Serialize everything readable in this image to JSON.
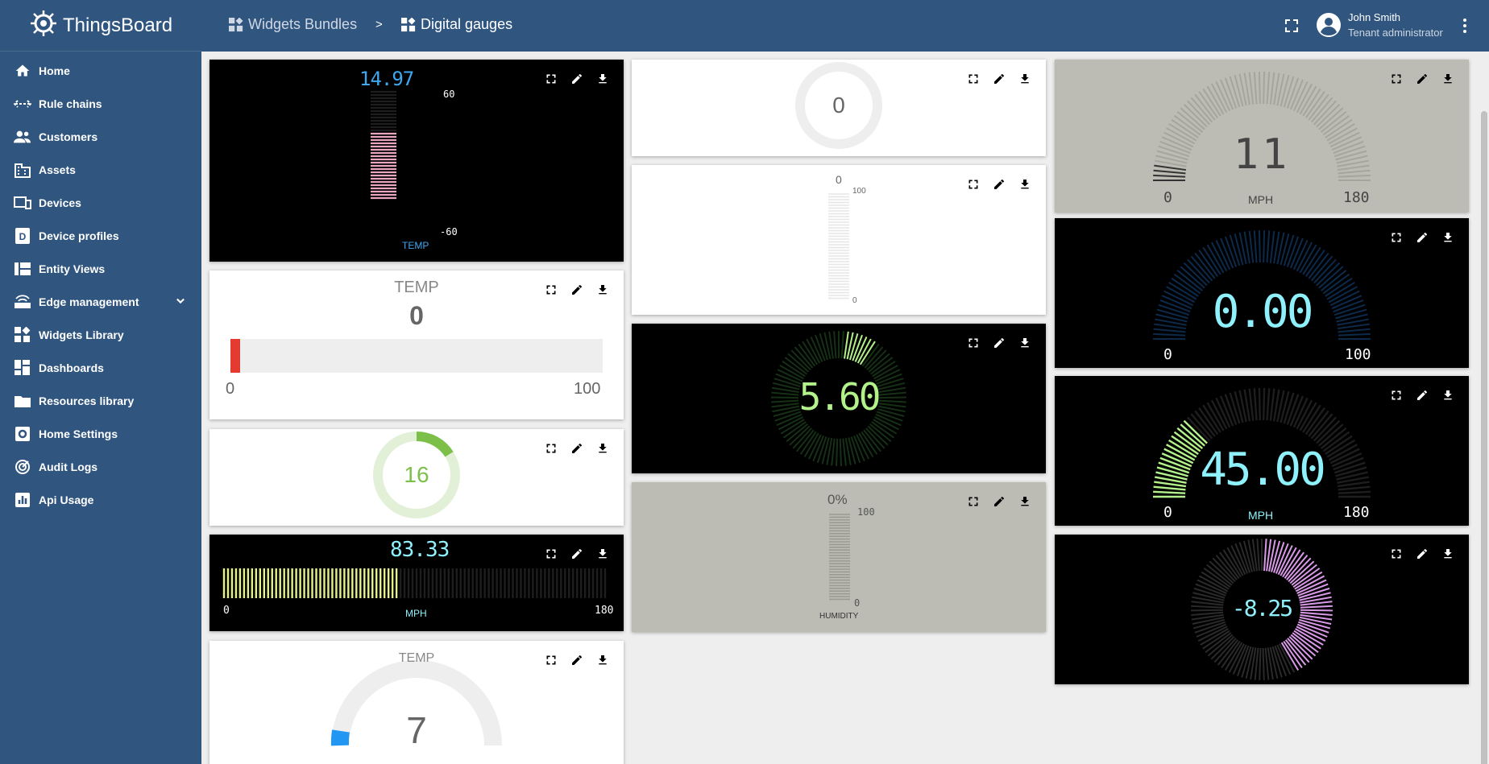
{
  "app": {
    "name": "ThingsBoard"
  },
  "sidebar": {
    "items": [
      {
        "label": "Home",
        "icon": "home-icon"
      },
      {
        "label": "Rule chains",
        "icon": "rule-chain-icon"
      },
      {
        "label": "Customers",
        "icon": "customers-icon"
      },
      {
        "label": "Assets",
        "icon": "assets-icon"
      },
      {
        "label": "Devices",
        "icon": "devices-icon"
      },
      {
        "label": "Device profiles",
        "icon": "device-profile-icon"
      },
      {
        "label": "Entity Views",
        "icon": "entity-views-icon"
      },
      {
        "label": "Edge management",
        "icon": "edge-icon"
      },
      {
        "label": "Widgets Library",
        "icon": "widgets-icon"
      },
      {
        "label": "Dashboards",
        "icon": "dashboards-icon"
      },
      {
        "label": "Resources library",
        "icon": "folder-icon"
      },
      {
        "label": "Home Settings",
        "icon": "settings-icon"
      },
      {
        "label": "Audit Logs",
        "icon": "audit-icon"
      },
      {
        "label": "Api Usage",
        "icon": "api-usage-icon"
      }
    ]
  },
  "header": {
    "breadcrumb": [
      {
        "label": "Widgets Bundles"
      },
      {
        "label": "Digital gauges"
      }
    ],
    "separator": ">",
    "user": {
      "name": "John Smith",
      "role": "Tenant administrator"
    }
  },
  "widgets": {
    "w1": {
      "value": "14.97",
      "max": "60",
      "min": "-60",
      "label": "TEMP",
      "fill": 0.62
    },
    "w2": {
      "title": "TEMP",
      "value": "0",
      "min": "0",
      "max": "100"
    },
    "w3": {
      "value": "16",
      "fraction": 0.16
    },
    "w4": {
      "value": "83.33",
      "min": "0",
      "max": "180",
      "label": "MPH",
      "fill": 0.46
    },
    "w5": {
      "title": "TEMP",
      "value": "7"
    },
    "w6": {
      "value": "0"
    },
    "w7": {
      "value": "0",
      "max": "100",
      "min": "0"
    },
    "w8": {
      "value": "5.60"
    },
    "w9": {
      "value": "0%",
      "max": "100",
      "min": "0",
      "label": "HUMIDITY"
    },
    "w10": {
      "value": "11",
      "min": "0",
      "max": "180",
      "label": "MPH"
    },
    "w11": {
      "value": "0.00",
      "min": "0",
      "max": "100"
    },
    "w12": {
      "value": "45.00",
      "min": "0",
      "max": "180",
      "label": "MPH",
      "fill": 0.25
    },
    "w13": {
      "value": "-8.25"
    }
  },
  "colors": {
    "header": "#305680",
    "lcd_blue": "#3ea8f2",
    "lcd_cyan": "#8ef1fb",
    "bar_pink": "#e8a6c0",
    "bar_yellow": "#e6f28a",
    "green": "#7cc04a",
    "red": "#e53a2f",
    "arc_green": "#b3f18a",
    "arc_purple": "#d99ae8"
  }
}
